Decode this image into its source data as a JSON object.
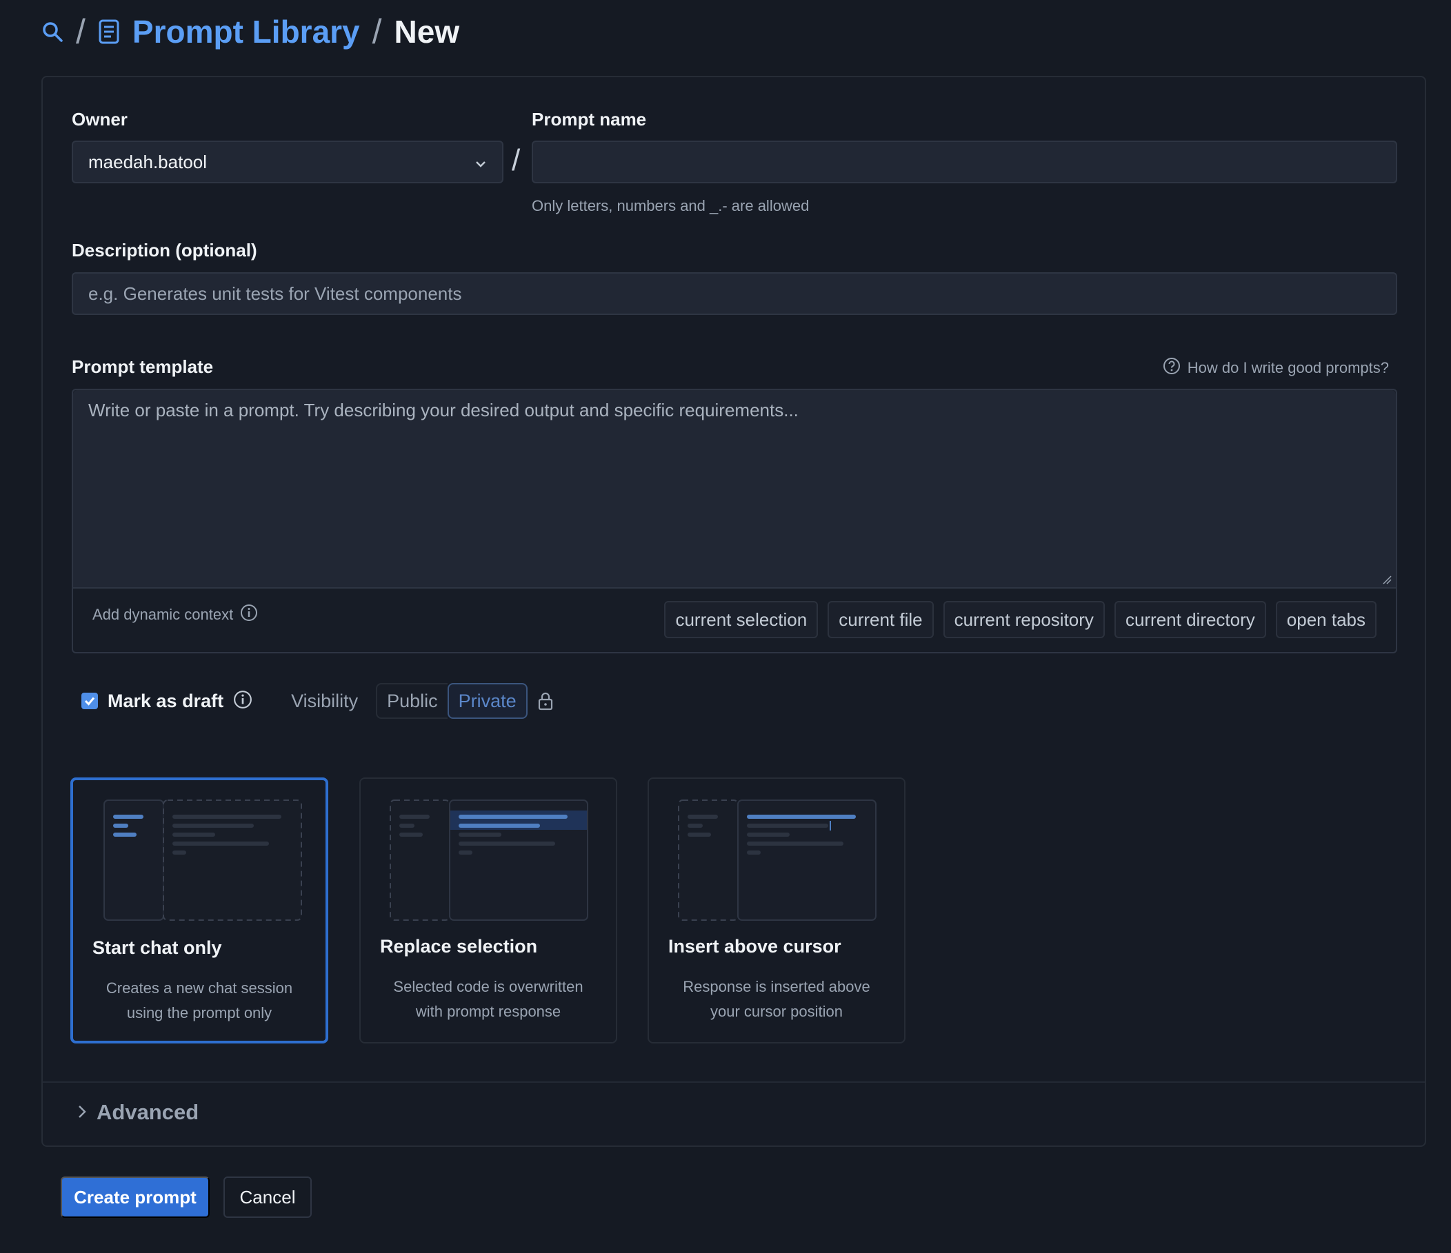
{
  "breadcrumb": {
    "library": "Prompt Library",
    "current": "New",
    "separator": "/"
  },
  "owner": {
    "label": "Owner",
    "value": "maedah.batool"
  },
  "prompt_name": {
    "label": "Prompt name",
    "value": "",
    "hint": "Only letters, numbers and _.- are allowed"
  },
  "description": {
    "label": "Description (optional)",
    "placeholder": "e.g. Generates unit tests for Vitest components"
  },
  "template": {
    "label": "Prompt template",
    "help_link": "How do I write good prompts?",
    "placeholder": "Write or paste in a prompt. Try describing your desired output and specific requirements...",
    "context_label": "Add dynamic context",
    "chips": [
      "current selection",
      "current file",
      "current repository",
      "current directory",
      "open tabs"
    ]
  },
  "draft": {
    "label": "Mark as draft",
    "checked": true
  },
  "visibility": {
    "label": "Visibility",
    "options": [
      "Public",
      "Private"
    ],
    "selected": "Private"
  },
  "modes": [
    {
      "title": "Start chat only",
      "desc_line1": "Creates a new chat session",
      "desc_line2": "using the prompt only",
      "selected": true
    },
    {
      "title": "Replace selection",
      "desc_line1": "Selected code is overwritten",
      "desc_line2": "with prompt response",
      "selected": false
    },
    {
      "title": "Insert above cursor",
      "desc_line1": "Response is inserted above",
      "desc_line2": "your cursor position",
      "selected": false
    }
  ],
  "advanced": {
    "label": "Advanced"
  },
  "actions": {
    "create": "Create prompt",
    "cancel": "Cancel"
  },
  "colors": {
    "background": "#151a23",
    "accent": "#2f6fd6",
    "link": "#5b9ef5"
  }
}
